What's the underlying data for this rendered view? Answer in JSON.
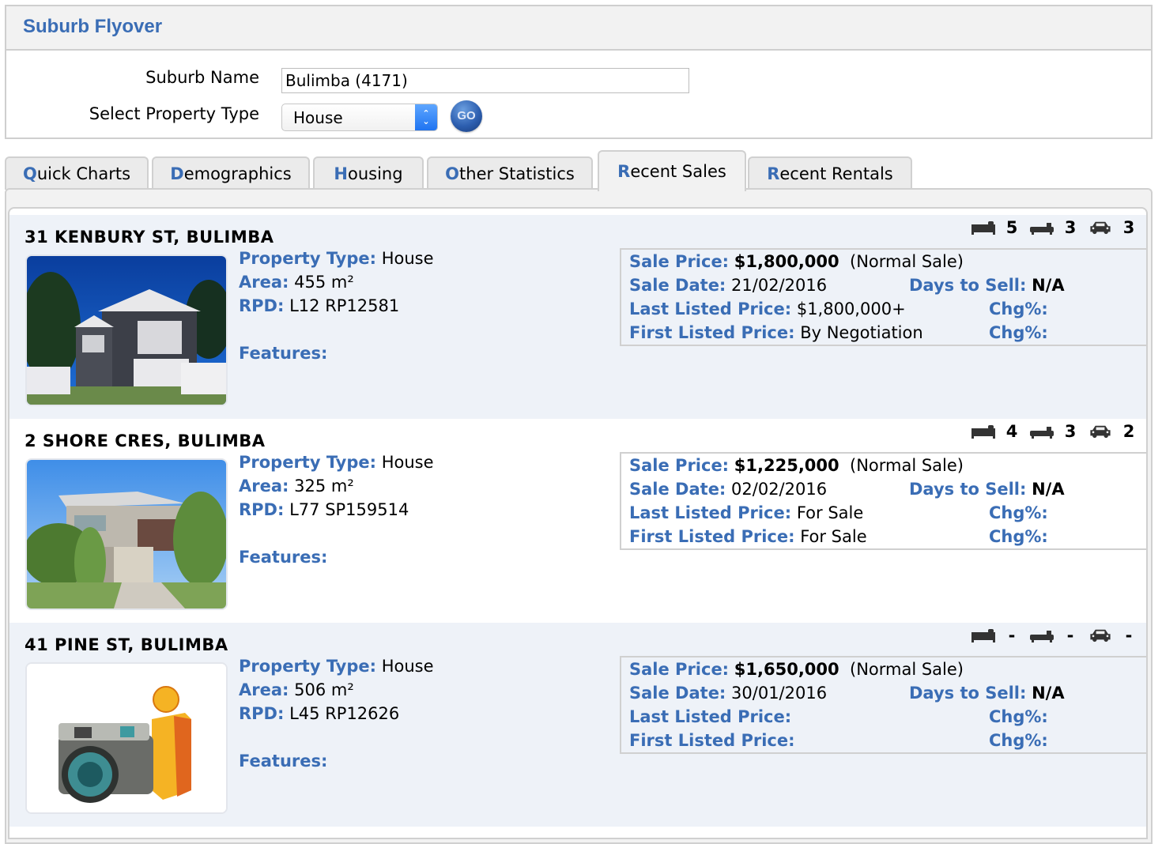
{
  "header": {
    "title": "Suburb Flyover",
    "suburb_label": "Suburb Name",
    "suburb_value": "Bulimba (4171)",
    "property_type_label": "Select Property Type",
    "property_type_value": "House",
    "go_label": "GO"
  },
  "tabs": [
    {
      "hotkey": "Q",
      "rest": "uick Charts",
      "active": false
    },
    {
      "hotkey": "D",
      "rest": "emographics",
      "active": false
    },
    {
      "hotkey": "H",
      "rest": "ousing",
      "active": false
    },
    {
      "hotkey": "O",
      "rest": "ther Statistics",
      "active": false
    },
    {
      "hotkey": "R",
      "rest": "ecent Sales",
      "active": true
    },
    {
      "hotkey": "R",
      "rest": "ecent Rentals",
      "active": false
    }
  ],
  "labels": {
    "property_type": "Property Type:",
    "area": "Area:",
    "rpd": "RPD:",
    "features": "Features:",
    "sale_price": "Sale Price:",
    "sale_date": "Sale Date:",
    "days_to_sell": "Days to Sell:",
    "last_listed": "Last Listed Price:",
    "first_listed": "First Listed Price:",
    "chg": "Chg%:"
  },
  "icons": {
    "bed": "bed-icon",
    "bath": "bath-icon",
    "car": "car-icon"
  },
  "listings": [
    {
      "address": "31 KENBURY ST, BULIMBA",
      "beds": "5",
      "baths": "3",
      "cars": "3",
      "property_type": "House",
      "area": "455 m²",
      "rpd": "L12 RP12581",
      "features": "",
      "sale_price": "$1,800,000",
      "sale_type": "(Normal Sale)",
      "sale_date": "21/02/2016",
      "days_to_sell": "N/A",
      "last_listed": "$1,800,000+",
      "last_chg": "",
      "first_listed": "By Negotiation",
      "first_chg": "",
      "photo": "house-photo"
    },
    {
      "address": "2 SHORE CRES, BULIMBA",
      "beds": "4",
      "baths": "3",
      "cars": "2",
      "property_type": "House",
      "area": "325 m²",
      "rpd": "L77 SP159514",
      "features": "",
      "sale_price": "$1,225,000",
      "sale_type": "(Normal Sale)",
      "sale_date": "02/02/2016",
      "days_to_sell": "N/A",
      "last_listed": "For Sale",
      "last_chg": "",
      "first_listed": "For Sale",
      "first_chg": "",
      "photo": "house-photo"
    },
    {
      "address": "41 PINE ST, BULIMBA",
      "beds": "-",
      "baths": "-",
      "cars": "-",
      "property_type": "House",
      "area": "506 m²",
      "rpd": "L45 RP12626",
      "features": "",
      "sale_price": "$1,650,000",
      "sale_type": "(Normal Sale)",
      "sale_date": "30/01/2016",
      "days_to_sell": "N/A",
      "last_listed": "",
      "last_chg": "",
      "first_listed": "",
      "first_chg": "",
      "photo": "no-photo-placeholder"
    }
  ],
  "colors": {
    "accent": "#3a6db5",
    "row_alt": "#eef2f8"
  }
}
